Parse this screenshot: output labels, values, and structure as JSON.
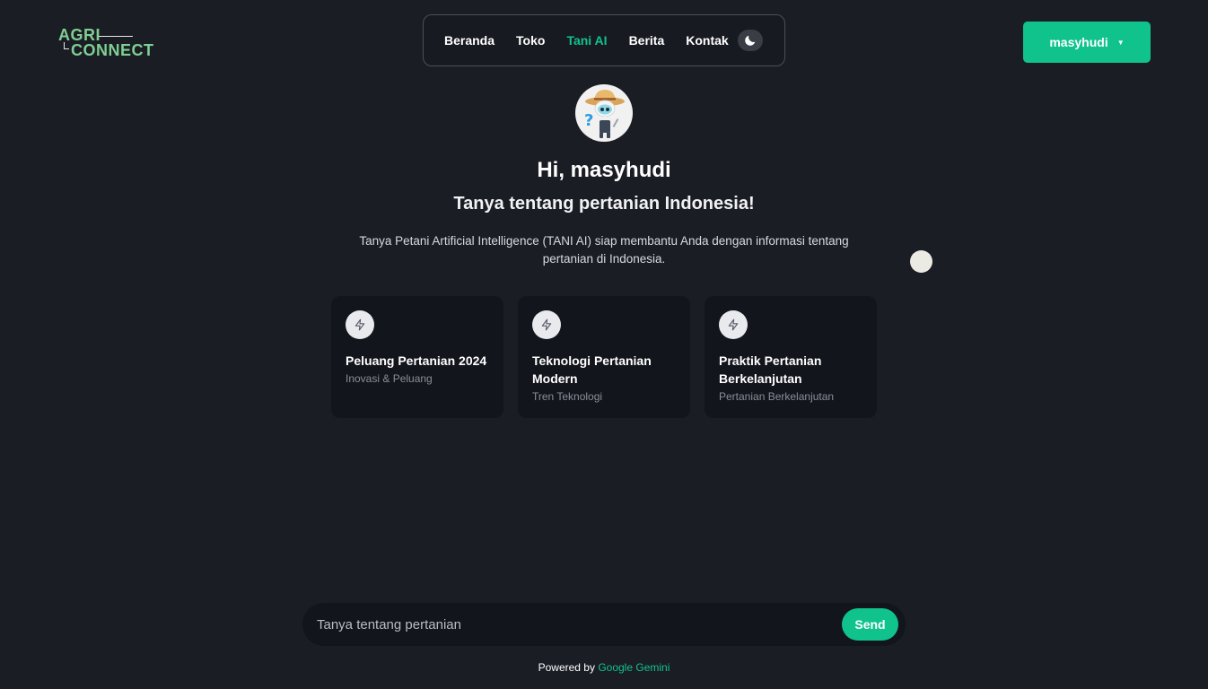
{
  "logo": {
    "line1": "AGRI",
    "line2": "CONNECT",
    "accent_color": "#7fce92"
  },
  "nav": {
    "items": [
      {
        "label": "Beranda",
        "active": false
      },
      {
        "label": "Toko",
        "active": false
      },
      {
        "label": "Tani AI",
        "active": true
      },
      {
        "label": "Berita",
        "active": false
      },
      {
        "label": "Kontak",
        "active": false
      }
    ],
    "theme_icon": "moon-icon"
  },
  "user": {
    "name": "masyhudi",
    "caret_icon": "caret-down-icon"
  },
  "hero": {
    "greeting": "Hi, masyhudi",
    "subtitle": "Tanya tentang pertanian Indonesia!",
    "description": "Tanya Petani Artificial Intelligence (TANI AI) siap membantu Anda dengan informasi tentang pertanian di Indonesia."
  },
  "cards": [
    {
      "title": "Peluang Pertanian 2024",
      "subtitle": "Inovasi & Peluang",
      "icon": "lightning-icon"
    },
    {
      "title": "Teknologi Pertanian Modern",
      "subtitle": "Tren Teknologi",
      "icon": "lightning-icon"
    },
    {
      "title": "Praktik Pertanian Berkelanjutan",
      "subtitle": "Pertanian Berkelanjutan",
      "icon": "lightning-icon"
    }
  ],
  "chat": {
    "placeholder": "Tanya tentang pertanian",
    "value": "",
    "send_label": "Send"
  },
  "footer": {
    "prefix": "Powered by",
    "brand": "Google Gemini"
  },
  "colors": {
    "accent": "#10c38c",
    "background": "#1b1d25",
    "card": "#13151c"
  }
}
